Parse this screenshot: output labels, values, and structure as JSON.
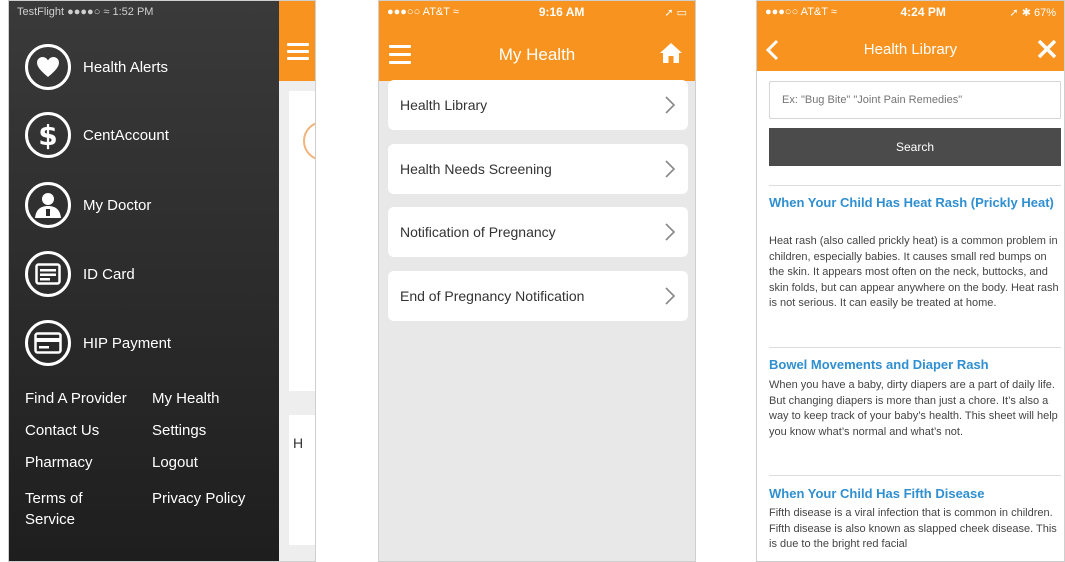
{
  "phone1": {
    "status": {
      "left": "TestFlight ●●●●○ ≈ 1:52 PM"
    },
    "menu_items": [
      {
        "label": "Health Alerts",
        "icon": "heart-icon"
      },
      {
        "label": "CentAccount",
        "icon": "dollar-icon"
      },
      {
        "label": "My Doctor",
        "icon": "doctor-icon"
      },
      {
        "label": "ID Card",
        "icon": "id-card-icon"
      },
      {
        "label": "HIP Payment",
        "icon": "credit-card-icon"
      }
    ],
    "links": {
      "find_provider": "Find A Provider",
      "my_health": "My Health",
      "contact_us": "Contact Us",
      "settings": "Settings",
      "pharmacy": "Pharmacy",
      "logout": "Logout",
      "terms": "Terms of Service",
      "privacy": "Privacy Policy"
    },
    "behind_text": "H"
  },
  "phone2": {
    "status": {
      "carrier": "●●●○○ AT&T ≈",
      "time": "9:16 AM",
      "right": "➚ ▭"
    },
    "title": "My Health",
    "rows": [
      "Health Library",
      "Health Needs Screening",
      "Notification of Pregnancy",
      "End of Pregnancy Notification"
    ]
  },
  "phone3": {
    "status": {
      "carrier": "●●●○○ AT&T ≈",
      "time": "4:24 PM",
      "right": "➚ ✱ 67%"
    },
    "title": "Health Library",
    "search": {
      "placeholder": "Ex: \"Bug Bite\" \"Joint Pain Remedies\"",
      "button": "Search"
    },
    "articles": [
      {
        "title": "When Your Child Has Heat Rash (Prickly Heat)",
        "body": "Heat rash (also called prickly heat) is a common problem in children, especially babies. It causes small red bumps on the skin. It appears most often on the neck, buttocks, and skin folds, but can appear anywhere on the body. Heat rash is not serious. It can easily be treated at home."
      },
      {
        "title": "Bowel Movements and Diaper Rash",
        "body": "When you have a baby, dirty diapers are a part of daily life. But changing diapers is more than just a chore. It’s also a way to keep track of your baby’s health. This sheet will help you know what’s normal and what’s not."
      },
      {
        "title": "When Your Child Has Fifth Disease",
        "body": "Fifth disease is a viral infection that is common in children. Fifth disease is also known as slapped cheek disease. This is due to the bright red facial"
      }
    ]
  },
  "colors": {
    "accent": "#f7931e",
    "link": "#2f8fd0",
    "button": "#4b4b4b"
  }
}
